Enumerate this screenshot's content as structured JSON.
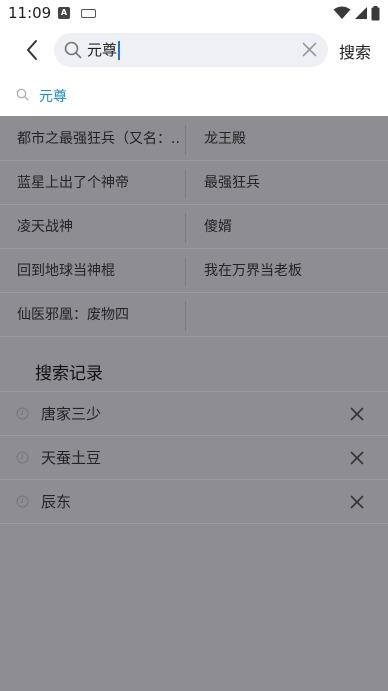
{
  "status_bar": {
    "time": "11:09",
    "notification_letter": "A",
    "icons": [
      "notification-a-icon",
      "keyboard-icon",
      "wifi-icon",
      "signal-icon",
      "battery-icon"
    ]
  },
  "search": {
    "query": "元尊",
    "submit_label": "搜索"
  },
  "suggestion": {
    "text": "元尊"
  },
  "hot_list": [
    {
      "left": "都市之最强狂兵（又名：...",
      "right": "龙王殿"
    },
    {
      "left": "蓝星上出了个神帝",
      "right": "最强狂兵"
    },
    {
      "left": "凌天战神",
      "right": "傻婿"
    },
    {
      "left": "回到地球当神棍",
      "right": "我在万界当老板"
    },
    {
      "left": "仙医邪凰：废物四",
      "right": ""
    }
  ],
  "history": {
    "title": "搜索记录",
    "items": [
      "唐家三少",
      "天蚕土豆",
      "辰东"
    ]
  },
  "colors": {
    "accent": "#1a8fd8",
    "overlay": "#8e8e92",
    "search_box": "#eef0f4"
  }
}
